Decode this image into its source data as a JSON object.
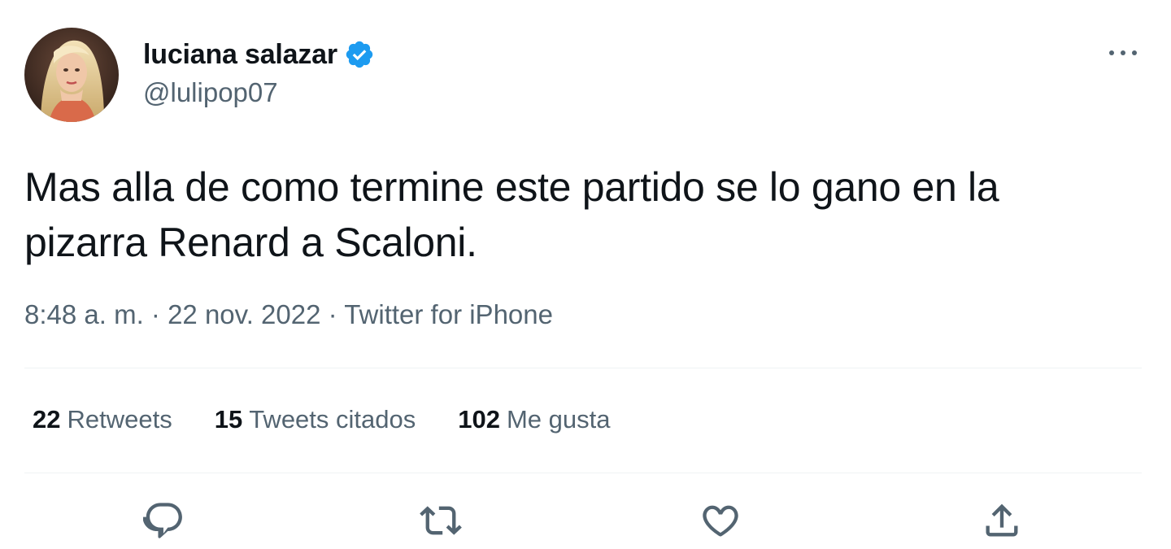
{
  "author": {
    "display_name": "luciana salazar",
    "handle": "@lulipop07",
    "verified": true,
    "avatar_icon": "profile-photo"
  },
  "tweet": {
    "text_line1": "Mas alla de como termine este partido se lo gano en la",
    "text_line2": "pizarra Renard a Scaloni.",
    "time": "8:48 a. m.",
    "date": "22 nov. 2022",
    "source": "Twitter for iPhone",
    "separator": " · "
  },
  "stats": [
    {
      "count": "22",
      "label": "Retweets"
    },
    {
      "count": "15",
      "label": "Tweets citados"
    },
    {
      "count": "102",
      "label": "Me gusta"
    }
  ],
  "actions": {
    "reply_icon": "reply-icon",
    "retweet_icon": "retweet-icon",
    "like_icon": "heart-icon",
    "share_icon": "share-icon"
  },
  "colors": {
    "verified_blue": "#1d9bf0",
    "secondary_text": "#536471",
    "primary_text": "#0f1419",
    "divider": "#eff3f4"
  }
}
